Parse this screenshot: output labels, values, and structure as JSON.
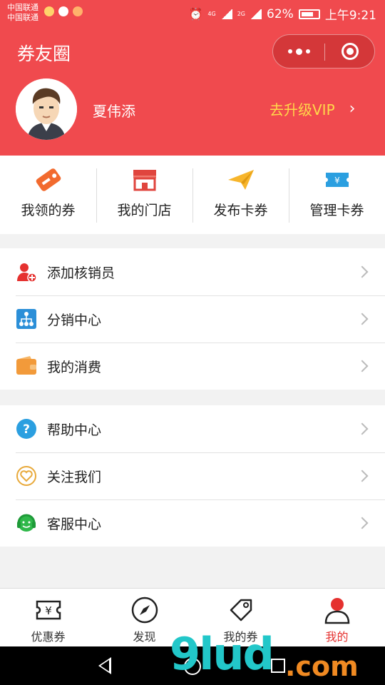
{
  "status": {
    "carrier1": "中国联通",
    "carrier2": "中国联通",
    "network": "4G",
    "network2": "2G",
    "battery": "62%",
    "time": "上午9:21"
  },
  "header": {
    "title": "券友圈",
    "user_name": "夏伟添",
    "vip_label": "去升级VIP"
  },
  "quick_actions": [
    {
      "label": "我领的券",
      "icon": "coupon-tag-icon"
    },
    {
      "label": "我的门店",
      "icon": "store-icon"
    },
    {
      "label": "发布卡券",
      "icon": "paper-plane-icon"
    },
    {
      "label": "管理卡券",
      "icon": "ticket-icon"
    }
  ],
  "menu_group1": [
    {
      "label": "添加核销员",
      "icon": "add-user-icon"
    },
    {
      "label": "分销中心",
      "icon": "hierarchy-icon"
    },
    {
      "label": "我的消费",
      "icon": "wallet-icon"
    }
  ],
  "menu_group2": [
    {
      "label": "帮助中心",
      "icon": "help-icon"
    },
    {
      "label": "关注我们",
      "icon": "heart-icon"
    },
    {
      "label": "客服中心",
      "icon": "headset-icon"
    }
  ],
  "tabbar": [
    {
      "label": "优惠券",
      "icon": "coupon-icon"
    },
    {
      "label": "发现",
      "icon": "compass-icon"
    },
    {
      "label": "我的券",
      "icon": "tag-icon"
    },
    {
      "label": "我的",
      "icon": "person-icon"
    }
  ],
  "watermark": {
    "text": "9lud",
    "suffix": ".com"
  },
  "colors": {
    "brand_red": "#f04a4e",
    "vip_yellow": "#ffd84a",
    "active_tab": "#e5312f"
  }
}
